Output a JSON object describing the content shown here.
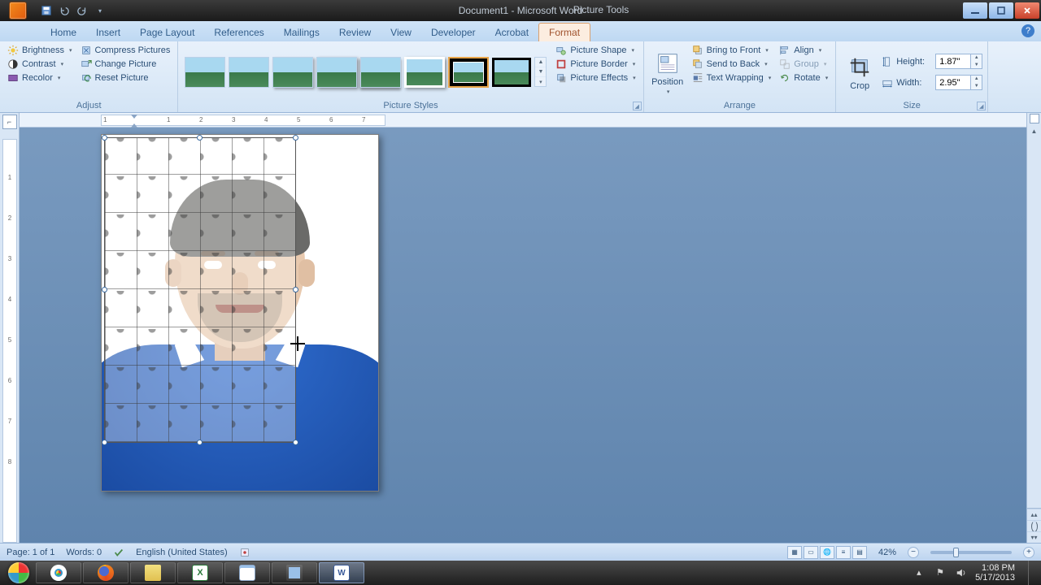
{
  "titlebar": {
    "document_title": "Document1 - Microsoft Word",
    "contextual_title": "Picture Tools"
  },
  "tabs": {
    "items": [
      "Home",
      "Insert",
      "Page Layout",
      "References",
      "Mailings",
      "Review",
      "View",
      "Developer",
      "Acrobat"
    ],
    "contextual": "Format"
  },
  "ribbon": {
    "adjust": {
      "label": "Adjust",
      "brightness": "Brightness",
      "contrast": "Contrast",
      "recolor": "Recolor",
      "compress": "Compress Pictures",
      "change": "Change Picture",
      "reset": "Reset Picture"
    },
    "styles": {
      "label": "Picture Styles",
      "shape": "Picture Shape",
      "border": "Picture Border",
      "effects": "Picture Effects"
    },
    "arrange": {
      "label": "Arrange",
      "position": "Position",
      "bring_front": "Bring to Front",
      "send_back": "Send to Back",
      "wrap": "Text Wrapping",
      "align": "Align",
      "group": "Group",
      "rotate": "Rotate"
    },
    "size": {
      "label": "Size",
      "crop": "Crop",
      "height_label": "Height:",
      "width_label": "Width:",
      "height_value": "1.87\"",
      "width_value": "2.95\""
    }
  },
  "ruler": {
    "numbers": [
      "1",
      "1",
      "2",
      "3",
      "4",
      "5",
      "6",
      "7"
    ]
  },
  "status": {
    "page": "Page: 1 of 1",
    "words": "Words: 0",
    "language": "English (United States)",
    "zoom": "42%"
  },
  "tray": {
    "time": "1:08 PM",
    "date": "5/17/2013"
  }
}
